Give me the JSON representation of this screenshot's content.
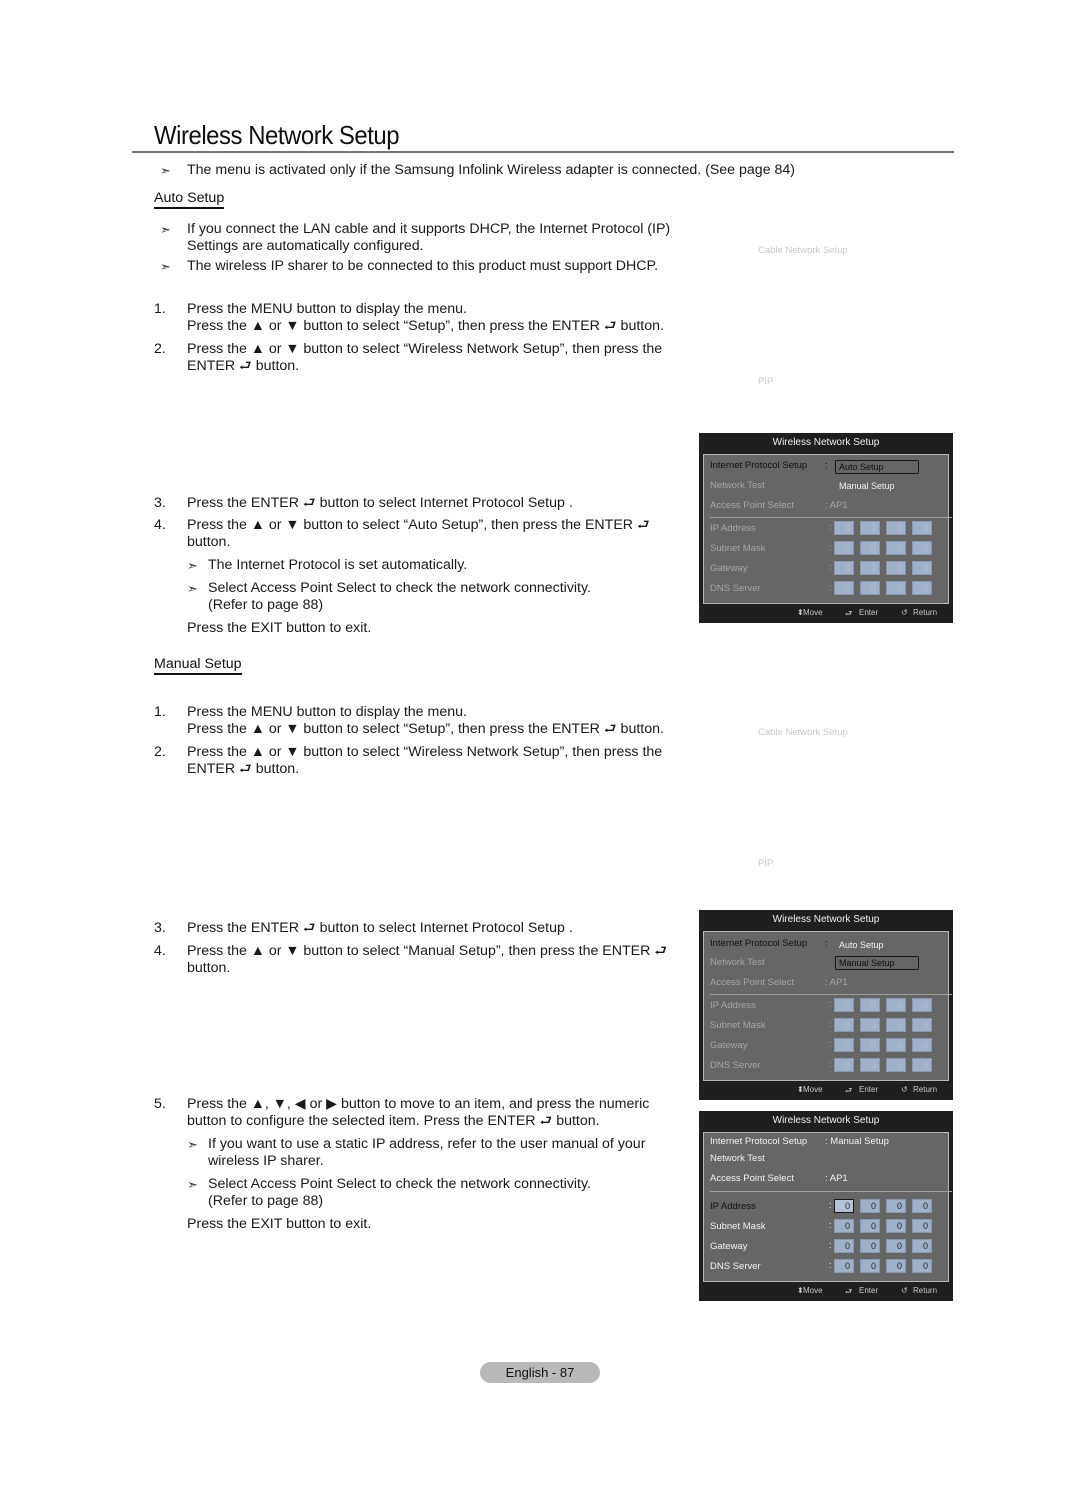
{
  "page": {
    "title": "Wireless Network Setup",
    "intro_note": "The menu is activated only if the Samsung Infolink Wireless adapter is connected. (See page 84)",
    "footer_badge": "English - 87"
  },
  "icons": {
    "note_arrow": "➣",
    "enter": "⮐",
    "updown": "⬍",
    "return": "↺"
  },
  "auto_setup": {
    "heading": "Auto Setup",
    "notes": [
      {
        "line1": "If you connect the LAN cable and it supports DHCP, the Internet Protocol (IP)",
        "line2": "Settings are automatically configured."
      },
      {
        "line1": "The wireless IP sharer to be connected to this product must support DHCP."
      }
    ],
    "steps": [
      {
        "num": "1.",
        "line1": "Press the MENU button to display the menu.",
        "line2": "Press the ▲ or ▼ button to select “Setup”, then press the ENTER ⮐ button."
      },
      {
        "num": "2.",
        "line1": "Press the ▲ or ▼ button to select “Wireless Network Setup”, then press the",
        "line2": "ENTER ⮐ button."
      },
      {
        "num": "3.",
        "line1": "Press the ENTER ⮐ button to select  Internet Protocol Setup ."
      },
      {
        "num": "4.",
        "line1": "Press the ▲ or ▼ button to select “Auto Setup”, then press the ENTER ⮐",
        "line2": "button."
      }
    ],
    "sub_notes": [
      {
        "line1": "The Internet Protocol is set automatically."
      },
      {
        "line1": "Select  Access Point Select  to check the network connectivity.",
        "line2": "(Refer to page 88)"
      }
    ],
    "exit": "Press the EXIT button to exit.",
    "ghost_labels": [
      "Cable Network Setup",
      "PIP"
    ]
  },
  "manual_setup": {
    "heading": "Manual Setup",
    "steps": [
      {
        "num": "1.",
        "line1": "Press the MENU button to display the menu.",
        "line2": "Press the ▲ or ▼ button to select “Setup”, then press the ENTER ⮐ button."
      },
      {
        "num": "2.",
        "line1": "Press the ▲ or ▼ button to select “Wireless Network Setup”, then press the",
        "line2": "ENTER ⮐ button."
      },
      {
        "num": "3.",
        "line1": "Press the ENTER ⮐ button to select  Internet Protocol Setup ."
      },
      {
        "num": "4.",
        "line1": "Press the ▲ or ▼ button to select “Manual Setup”, then press the ENTER ⮐",
        "line2": "button."
      },
      {
        "num": "5.",
        "line1": "Press the ▲, ▼, ◀ or ▶ button to move to an item, and press the numeric",
        "line2": "button to configure the selected item. Press the ENTER ⮐ button."
      }
    ],
    "sub_notes": [
      {
        "line1": "If you want to use a static IP address, refer to the user manual of your",
        "line2": "wireless IP sharer."
      },
      {
        "line1": "Select  Access Point Select  to check the network connectivity.",
        "line2": "(Refer to page 88)"
      }
    ],
    "exit": "Press the EXIT button to exit.",
    "ghost_labels": [
      "Cable Network Setup",
      "PIP"
    ]
  },
  "osd": {
    "title": "Wireless Network Setup",
    "labels": {
      "ip_setup": "Internet Protocol Setup",
      "network_test": "Network Test",
      "ap_select": "Access Point Select",
      "ip_address": "IP Address",
      "subnet_mask": "Subnet Mask",
      "gateway": "Gateway",
      "dns_server": "DNS Server"
    },
    "options": [
      "Auto Setup",
      "Manual Setup"
    ],
    "ap_value": ": AP1",
    "ip_value_manual": ": Manual Setup",
    "colon": ":",
    "octet": "0",
    "footer": {
      "move": "Move",
      "enter": "Enter",
      "return": "Return"
    },
    "colors": {
      "header_bg": "#1f1f1f",
      "panel_bg": "#666666",
      "cell_bg": "#9fb0c8",
      "disabled_text": "#a6a6a6"
    }
  }
}
